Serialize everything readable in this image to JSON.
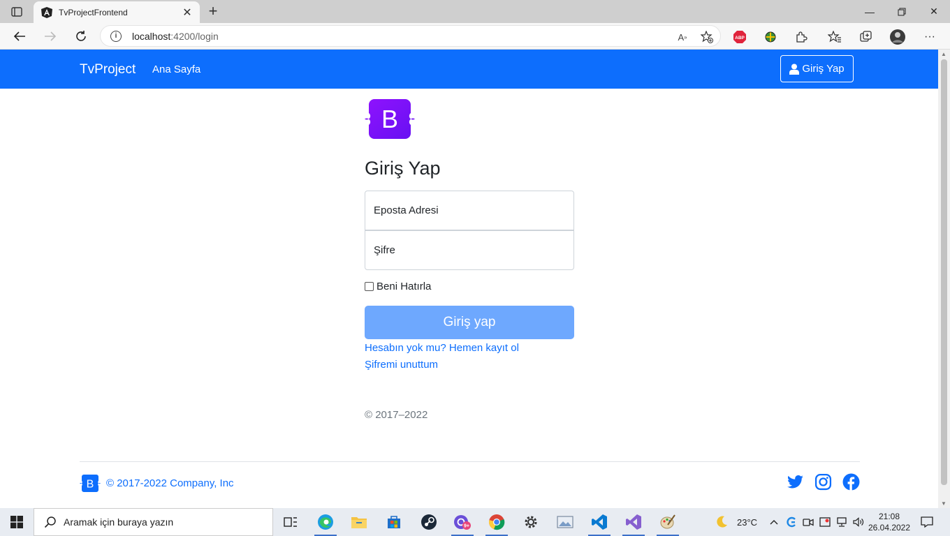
{
  "browser": {
    "tab_title": "TvProjectFrontend",
    "url_host": "localhost",
    "url_rest": ":4200/login"
  },
  "navbar": {
    "brand": "TvProject",
    "home_link": "Ana Sayfa",
    "login_button": "Giriş Yap"
  },
  "form": {
    "logo_letter": "B",
    "title": "Giriş Yap",
    "email_placeholder": "Eposta Adresi",
    "password_placeholder": "Şifre",
    "remember_label": "Beni Hatırla",
    "submit_label": "Giriş yap",
    "register_link": "Hesabın yok mu? Hemen kayıt ol",
    "forgot_link": "Şifremi unuttum",
    "copyright": "© 2017–2022"
  },
  "footer": {
    "logo_letter": "B",
    "text": "© 2017-2022 Company, Inc",
    "social": [
      "twitter-icon",
      "instagram-icon",
      "facebook-icon"
    ]
  },
  "taskbar": {
    "search_placeholder": "Aramak için buraya yazın",
    "weather": "23°C",
    "time": "21:08",
    "date": "26.04.2022",
    "badge": "9+"
  },
  "colors": {
    "primary": "#0d6efd",
    "submit_disabled": "#6ea8fe",
    "bootstrap_purple": "#7952b3"
  }
}
